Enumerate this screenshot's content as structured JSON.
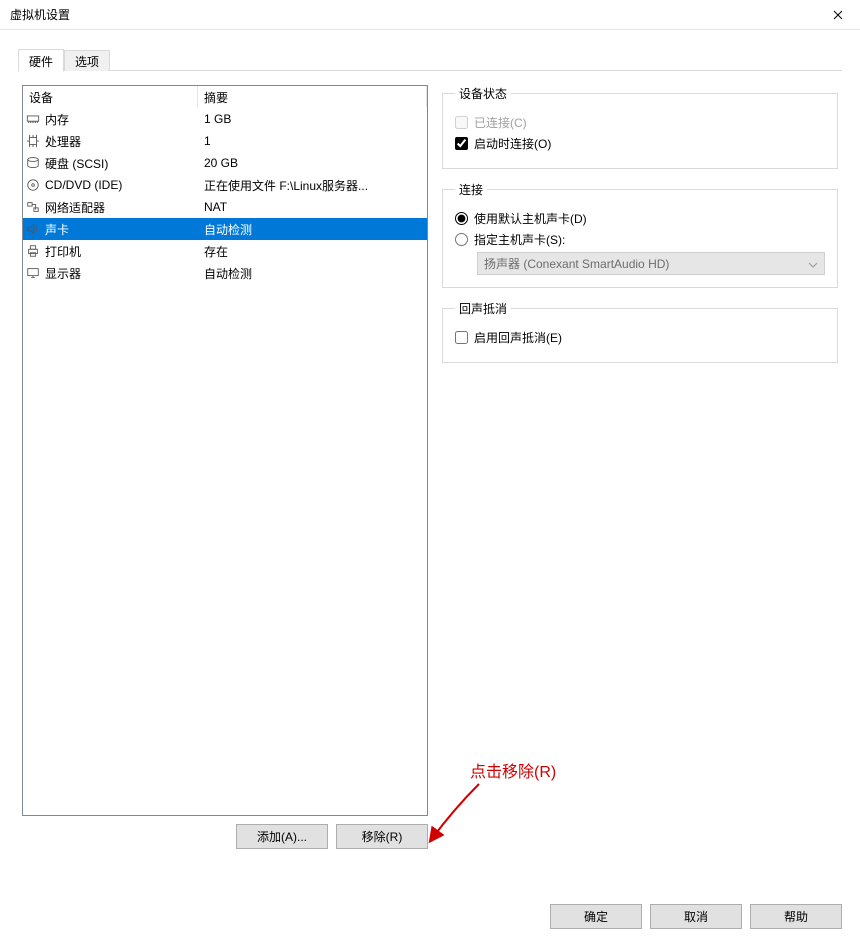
{
  "window": {
    "title": "虚拟机设置"
  },
  "tabs": {
    "hardware": "硬件",
    "options": "选项"
  },
  "device_table": {
    "head_device": "设备",
    "head_summary": "摘要",
    "rows": [
      {
        "icon": "memory-icon",
        "name": "内存",
        "summary": "1 GB"
      },
      {
        "icon": "cpu-icon",
        "name": "处理器",
        "summary": "1"
      },
      {
        "icon": "disk-icon",
        "name": "硬盘 (SCSI)",
        "summary": "20 GB"
      },
      {
        "icon": "disc-icon",
        "name": "CD/DVD (IDE)",
        "summary": "正在使用文件 F:\\Linux服务器..."
      },
      {
        "icon": "network-icon",
        "name": "网络适配器",
        "summary": "NAT"
      },
      {
        "icon": "sound-icon",
        "name": "声卡",
        "summary": "自动检测",
        "selected": true
      },
      {
        "icon": "printer-icon",
        "name": "打印机",
        "summary": "存在"
      },
      {
        "icon": "display-icon",
        "name": "显示器",
        "summary": "自动检测"
      }
    ]
  },
  "left_buttons": {
    "add": "添加(A)...",
    "remove": "移除(R)"
  },
  "right_panel": {
    "device_state": {
      "legend": "设备状态",
      "connected": "已连接(C)",
      "connect_on_power": "启动时连接(O)"
    },
    "connection": {
      "legend": "连接",
      "use_default": "使用默认主机声卡(D)",
      "specify_host": "指定主机声卡(S):",
      "host_device_value": "扬声器 (Conexant SmartAudio HD)"
    },
    "echo_cancel": {
      "legend": "回声抵消",
      "enable": "启用回声抵消(E)"
    }
  },
  "footer": {
    "ok": "确定",
    "cancel": "取消",
    "help": "帮助"
  },
  "annotation": {
    "text": "点击移除(R)"
  }
}
